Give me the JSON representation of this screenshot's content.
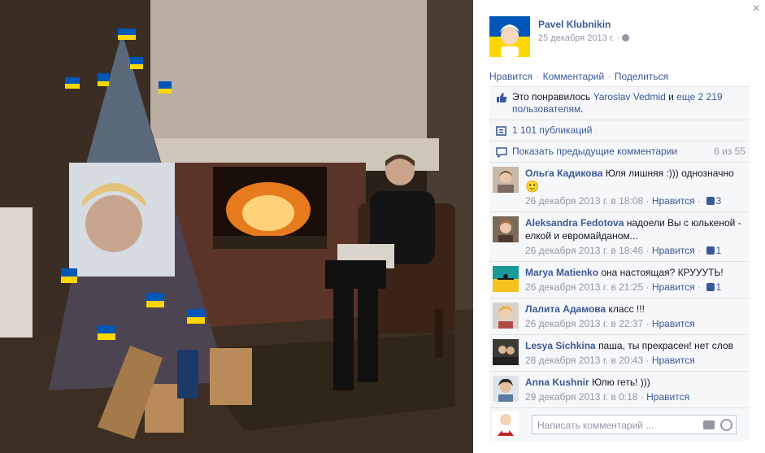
{
  "post": {
    "author": "Pavel Klubnikin",
    "date": "25 декабря 2013 г. ·",
    "close_icon": "close-icon",
    "actions": [
      "Нравится",
      "Комментарий",
      "Поделиться"
    ]
  },
  "likes": {
    "prefix": "Это понравилось ",
    "liker": "Yaroslav Vedmid",
    "connector": " и ",
    "others": "еще 2 219 пользователям",
    "suffix": "."
  },
  "shares": {
    "text": "1 101 публикаций"
  },
  "previous": {
    "label": "Показать предыдущие комментарии",
    "count": "6 из 55"
  },
  "comments": [
    {
      "name": "Ольга Кадикова",
      "text": "Юля лишняя :))) однозначно",
      "emoji": "🙂",
      "date": "26 декабря 2013 г. в 18:08",
      "like": "Нравится",
      "likes": "3"
    },
    {
      "name": "Aleksandra Fedotova",
      "text": "надоели Вы с юлькеной - елкой и евромайданом...",
      "date": "26 декабря 2013 г. в 18:46",
      "like": "Нравится",
      "likes": "1"
    },
    {
      "name": "Marya Matienko",
      "text": "она настоящая? КРУУУТЬ!",
      "date": "26 декабря 2013 г. в 21:25",
      "like": "Нравится",
      "likes": "1"
    },
    {
      "name": "Лалита Адамова",
      "text": "класс !!!",
      "date": "26 декабря 2013 г. в 22:37",
      "like": "Нравится",
      "likes": ""
    },
    {
      "name": "Lesya Sichkina",
      "text": "паша, ты прекрасен! нет слов",
      "date": "28 декабря 2013 г. в 20:43",
      "like": "Нравится",
      "likes": ""
    },
    {
      "name": "Anna Kushnir",
      "text": "Юлю геть! )))",
      "date": "29 декабря 2013 г. в 0:18",
      "like": "Нравится",
      "likes": ""
    }
  ],
  "compose": {
    "placeholder": "Написать комментарий ..."
  },
  "colors": {
    "link": "#3b5998",
    "muted": "#9197a3",
    "panel_bg": "#f6f7f8",
    "flag_blue": "#0057b7",
    "flag_yellow": "#ffd700"
  }
}
